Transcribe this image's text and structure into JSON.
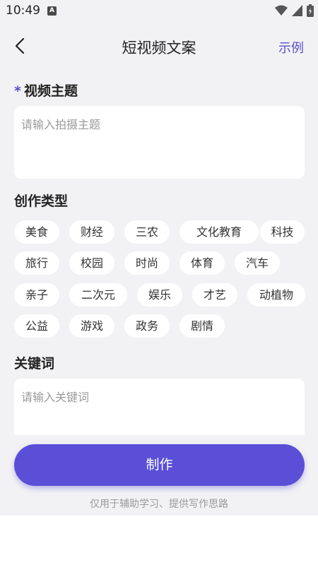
{
  "status": {
    "time": "10:49",
    "a_badge": "A"
  },
  "nav": {
    "title": "短视频文案",
    "example_label": "示例"
  },
  "topic": {
    "required_mark": "*",
    "title": "视频主题",
    "placeholder": "请输入拍摄主题"
  },
  "type_section": {
    "title": "创作类型",
    "chips": [
      "美食",
      "财经",
      "三农",
      "文化教育",
      "科技",
      "旅行",
      "校园",
      "时尚",
      "体育",
      "汽车",
      "亲子",
      "二次元",
      "娱乐",
      "才艺",
      "动植物",
      "公益",
      "游戏",
      "政务",
      "剧情"
    ]
  },
  "keywords": {
    "title": "关键词",
    "placeholder": "请输入关键词"
  },
  "action": {
    "make_label": "制作",
    "note": "仅用于辅助学习、提供写作思路"
  },
  "colors": {
    "accent": "#5a4fd6",
    "background": "#f2f2f4"
  }
}
